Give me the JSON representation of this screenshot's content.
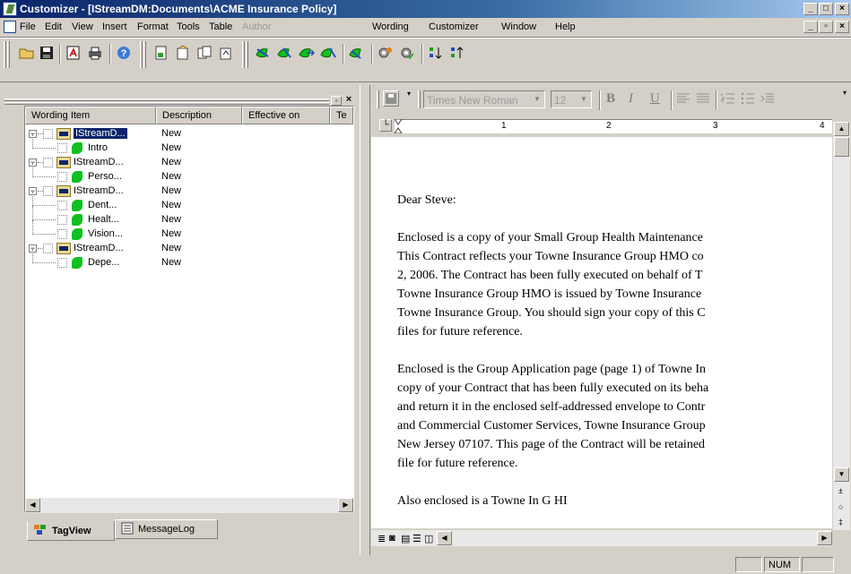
{
  "window": {
    "title": "Customizer - [IStreamDM:Documents\\ACME Insurance Policy]",
    "buttons": [
      "_",
      "□",
      "×"
    ],
    "mdi_buttons": [
      "_",
      "▫",
      "×"
    ]
  },
  "menu": {
    "items": [
      {
        "label": "File",
        "disabled": false
      },
      {
        "label": "Edit",
        "disabled": false
      },
      {
        "label": "View",
        "disabled": false
      },
      {
        "label": "Insert",
        "disabled": false
      },
      {
        "label": "Format",
        "disabled": false
      },
      {
        "label": "Tools",
        "disabled": false
      },
      {
        "label": "Table",
        "disabled": false
      },
      {
        "label": "Author",
        "disabled": true
      },
      {
        "label": "Wording",
        "disabled": false
      },
      {
        "label": "Customizer",
        "disabled": false
      },
      {
        "label": "Window",
        "disabled": false
      },
      {
        "label": "Help",
        "disabled": false
      }
    ]
  },
  "toolbar": {
    "icons": [
      "open-folder-icon",
      "save-icon",
      "pdf-icon",
      "print-icon",
      "help-icon",
      "new-doc-icon",
      "doc-open-icon",
      "doc-stack-icon",
      "doc-up-icon",
      "wording-add-icon",
      "wording-edit-icon",
      "wording-move-icon",
      "wording-remove-icon",
      "wording-check-icon",
      "settings-gear-icon",
      "gear-check-icon",
      "sort-asc-icon",
      "sort-desc-icon"
    ]
  },
  "format_toolbar": {
    "font": "Times New Roman",
    "size": "12",
    "bold": "B",
    "italic": "I",
    "underline": "U"
  },
  "ruler": {
    "marks": [
      "1",
      "2",
      "3",
      "4"
    ]
  },
  "tree": {
    "columns": [
      "Wording Item",
      "Description",
      "Effective on",
      "Te"
    ],
    "rows": [
      {
        "level": 0,
        "label": "IStreamD...",
        "desc": "New",
        "selected": true,
        "type": "folder"
      },
      {
        "level": 1,
        "label": "Intro",
        "desc": "New",
        "selected": false,
        "type": "leaf"
      },
      {
        "level": 0,
        "label": "IStreamD...",
        "desc": "New",
        "selected": false,
        "type": "folder"
      },
      {
        "level": 1,
        "label": "Perso...",
        "desc": "New",
        "selected": false,
        "type": "leaf"
      },
      {
        "level": 0,
        "label": "IStreamD...",
        "desc": "New",
        "selected": false,
        "type": "folder"
      },
      {
        "level": 1,
        "label": "Dent...",
        "desc": "New",
        "selected": false,
        "type": "leaf"
      },
      {
        "level": 1,
        "label": "Healt...",
        "desc": "New",
        "selected": false,
        "type": "leaf"
      },
      {
        "level": 1,
        "label": "Vision...",
        "desc": "New",
        "selected": false,
        "type": "leaf"
      },
      {
        "level": 0,
        "label": "IStreamD...",
        "desc": "New",
        "selected": false,
        "type": "folder"
      },
      {
        "level": 1,
        "label": "Depe...",
        "desc": "New",
        "selected": false,
        "type": "leaf"
      }
    ]
  },
  "tabs": [
    {
      "label": "TagView",
      "active": true
    },
    {
      "label": "MessageLog",
      "active": false
    }
  ],
  "document": {
    "lines": [
      "Dear Steve:",
      "",
      "Enclosed is a copy of your Small Group Health Maintenance",
      "This Contract reflects your Towne Insurance Group HMO co",
      "2, 2006.  The Contract has been fully executed on behalf of T",
      "Towne Insurance Group HMO is issued by Towne Insurance",
      "Towne Insurance Group.  You should sign your copy of this C",
      "files for future reference.",
      "",
      "Enclosed is the Group Application page (page 1) of Towne In",
      "copy of your Contract that has been fully executed on its beha",
      "and return it in the enclosed self-addressed envelope to Contr",
      "and Commercial Customer Services, Towne Insurance Group",
      "New Jersey 07107.  This page of the Contract will be retained",
      "file for future reference.",
      "",
      "Also enclosed is a                    Towne In      G        HI"
    ]
  },
  "status": {
    "num": "NUM"
  }
}
